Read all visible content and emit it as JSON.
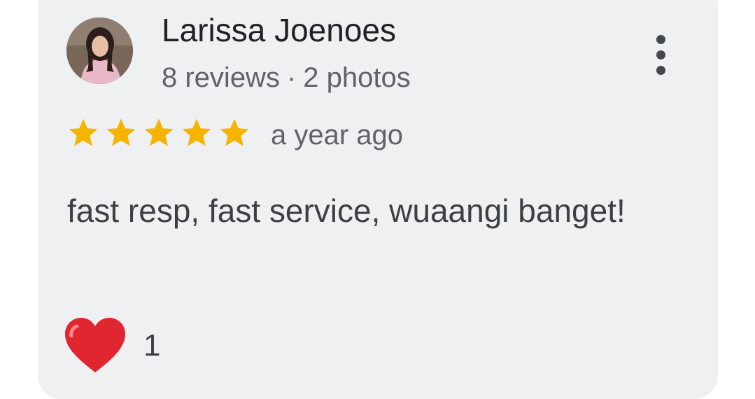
{
  "review": {
    "author": "Larissa Joenoes",
    "reviews_count": "8 reviews",
    "separator": "·",
    "photos_count": "2 photos",
    "rating": 5,
    "rating_max": 5,
    "time": "a year ago",
    "text": "fast resp, fast service, wuaangi banget!",
    "reaction_count": "1"
  },
  "icons": {
    "avatar": "profile-photo",
    "more": "more-vertical-icon",
    "star": "star-icon",
    "heart": "heart-icon"
  },
  "colors": {
    "card": "#eff0f2",
    "star": "#f4b400",
    "heart": "#e0262f",
    "text_primary": "#202124",
    "text_secondary": "#5f6368"
  }
}
